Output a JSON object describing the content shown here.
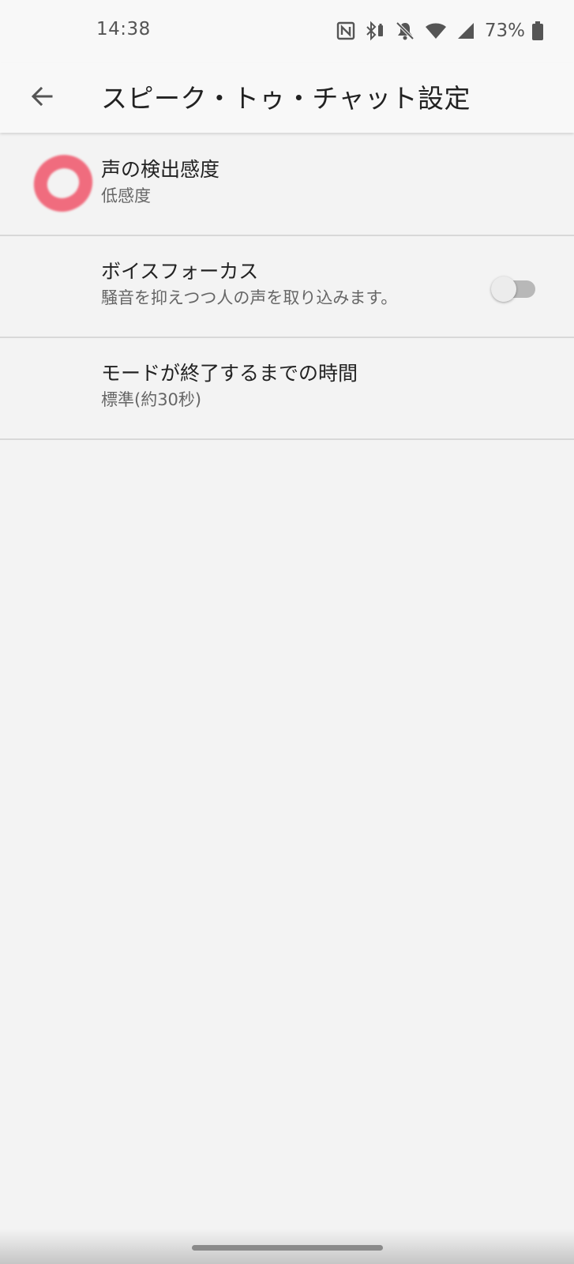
{
  "status_bar": {
    "time": "14:38",
    "battery_percent": "73%",
    "icons": [
      "nfc-icon",
      "bluetooth-battery-icon",
      "notifications-off-icon",
      "wifi-icon",
      "cellular-signal-icon",
      "battery-icon"
    ]
  },
  "app_bar": {
    "back_icon": "arrow-back-icon",
    "title": "スピーク・トゥ・チャット設定"
  },
  "settings": [
    {
      "title": "声の検出感度",
      "summary": "低感度"
    },
    {
      "title": "ボイスフォーカス",
      "summary": "騒音を抑えつつ人の声を取り込みます。",
      "toggle_on": false
    },
    {
      "title": "モードが終了するまでの時間",
      "summary": "標準(約30秒)"
    }
  ],
  "colors": {
    "background": "#f3f3f3",
    "bar_background": "#f8f8f8",
    "divider": "#d8d8d8",
    "annotation_mark": "#f05a6e"
  }
}
